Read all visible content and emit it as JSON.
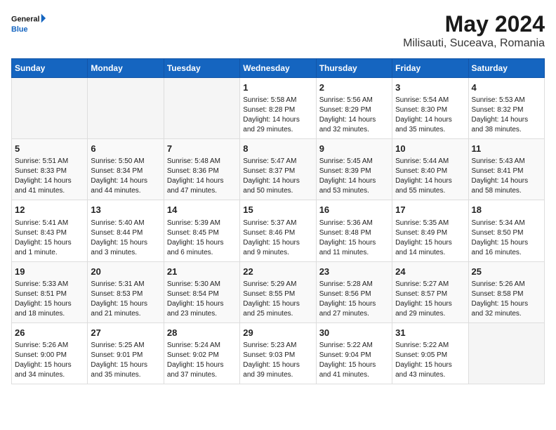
{
  "header": {
    "logo_text_normal": "General",
    "logo_text_blue": "Blue",
    "title": "May 2024",
    "subtitle": "Milisauti, Suceava, Romania"
  },
  "days_of_week": [
    "Sunday",
    "Monday",
    "Tuesday",
    "Wednesday",
    "Thursday",
    "Friday",
    "Saturday"
  ],
  "weeks": [
    [
      {
        "day": "",
        "info": ""
      },
      {
        "day": "",
        "info": ""
      },
      {
        "day": "",
        "info": ""
      },
      {
        "day": "1",
        "info": "Sunrise: 5:58 AM\nSunset: 8:28 PM\nDaylight: 14 hours\nand 29 minutes."
      },
      {
        "day": "2",
        "info": "Sunrise: 5:56 AM\nSunset: 8:29 PM\nDaylight: 14 hours\nand 32 minutes."
      },
      {
        "day": "3",
        "info": "Sunrise: 5:54 AM\nSunset: 8:30 PM\nDaylight: 14 hours\nand 35 minutes."
      },
      {
        "day": "4",
        "info": "Sunrise: 5:53 AM\nSunset: 8:32 PM\nDaylight: 14 hours\nand 38 minutes."
      }
    ],
    [
      {
        "day": "5",
        "info": "Sunrise: 5:51 AM\nSunset: 8:33 PM\nDaylight: 14 hours\nand 41 minutes."
      },
      {
        "day": "6",
        "info": "Sunrise: 5:50 AM\nSunset: 8:34 PM\nDaylight: 14 hours\nand 44 minutes."
      },
      {
        "day": "7",
        "info": "Sunrise: 5:48 AM\nSunset: 8:36 PM\nDaylight: 14 hours\nand 47 minutes."
      },
      {
        "day": "8",
        "info": "Sunrise: 5:47 AM\nSunset: 8:37 PM\nDaylight: 14 hours\nand 50 minutes."
      },
      {
        "day": "9",
        "info": "Sunrise: 5:45 AM\nSunset: 8:39 PM\nDaylight: 14 hours\nand 53 minutes."
      },
      {
        "day": "10",
        "info": "Sunrise: 5:44 AM\nSunset: 8:40 PM\nDaylight: 14 hours\nand 55 minutes."
      },
      {
        "day": "11",
        "info": "Sunrise: 5:43 AM\nSunset: 8:41 PM\nDaylight: 14 hours\nand 58 minutes."
      }
    ],
    [
      {
        "day": "12",
        "info": "Sunrise: 5:41 AM\nSunset: 8:43 PM\nDaylight: 15 hours\nand 1 minute."
      },
      {
        "day": "13",
        "info": "Sunrise: 5:40 AM\nSunset: 8:44 PM\nDaylight: 15 hours\nand 3 minutes."
      },
      {
        "day": "14",
        "info": "Sunrise: 5:39 AM\nSunset: 8:45 PM\nDaylight: 15 hours\nand 6 minutes."
      },
      {
        "day": "15",
        "info": "Sunrise: 5:37 AM\nSunset: 8:46 PM\nDaylight: 15 hours\nand 9 minutes."
      },
      {
        "day": "16",
        "info": "Sunrise: 5:36 AM\nSunset: 8:48 PM\nDaylight: 15 hours\nand 11 minutes."
      },
      {
        "day": "17",
        "info": "Sunrise: 5:35 AM\nSunset: 8:49 PM\nDaylight: 15 hours\nand 14 minutes."
      },
      {
        "day": "18",
        "info": "Sunrise: 5:34 AM\nSunset: 8:50 PM\nDaylight: 15 hours\nand 16 minutes."
      }
    ],
    [
      {
        "day": "19",
        "info": "Sunrise: 5:33 AM\nSunset: 8:51 PM\nDaylight: 15 hours\nand 18 minutes."
      },
      {
        "day": "20",
        "info": "Sunrise: 5:31 AM\nSunset: 8:53 PM\nDaylight: 15 hours\nand 21 minutes."
      },
      {
        "day": "21",
        "info": "Sunrise: 5:30 AM\nSunset: 8:54 PM\nDaylight: 15 hours\nand 23 minutes."
      },
      {
        "day": "22",
        "info": "Sunrise: 5:29 AM\nSunset: 8:55 PM\nDaylight: 15 hours\nand 25 minutes."
      },
      {
        "day": "23",
        "info": "Sunrise: 5:28 AM\nSunset: 8:56 PM\nDaylight: 15 hours\nand 27 minutes."
      },
      {
        "day": "24",
        "info": "Sunrise: 5:27 AM\nSunset: 8:57 PM\nDaylight: 15 hours\nand 29 minutes."
      },
      {
        "day": "25",
        "info": "Sunrise: 5:26 AM\nSunset: 8:58 PM\nDaylight: 15 hours\nand 32 minutes."
      }
    ],
    [
      {
        "day": "26",
        "info": "Sunrise: 5:26 AM\nSunset: 9:00 PM\nDaylight: 15 hours\nand 34 minutes."
      },
      {
        "day": "27",
        "info": "Sunrise: 5:25 AM\nSunset: 9:01 PM\nDaylight: 15 hours\nand 35 minutes."
      },
      {
        "day": "28",
        "info": "Sunrise: 5:24 AM\nSunset: 9:02 PM\nDaylight: 15 hours\nand 37 minutes."
      },
      {
        "day": "29",
        "info": "Sunrise: 5:23 AM\nSunset: 9:03 PM\nDaylight: 15 hours\nand 39 minutes."
      },
      {
        "day": "30",
        "info": "Sunrise: 5:22 AM\nSunset: 9:04 PM\nDaylight: 15 hours\nand 41 minutes."
      },
      {
        "day": "31",
        "info": "Sunrise: 5:22 AM\nSunset: 9:05 PM\nDaylight: 15 hours\nand 43 minutes."
      },
      {
        "day": "",
        "info": ""
      }
    ]
  ]
}
